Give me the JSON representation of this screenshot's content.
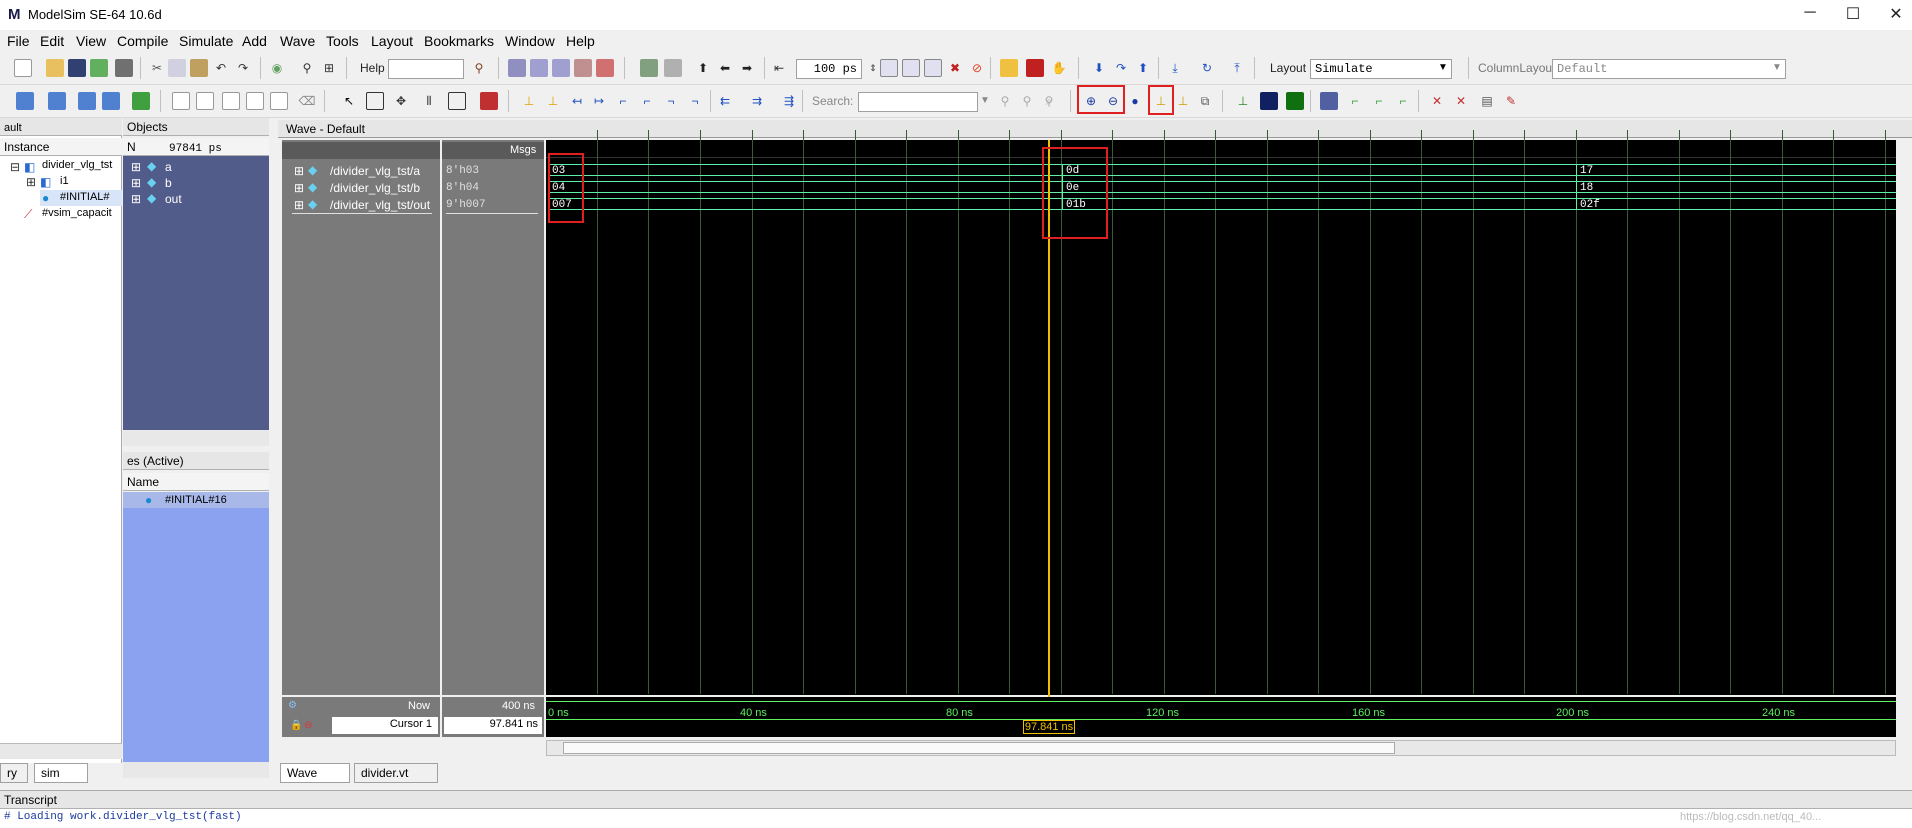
{
  "window": {
    "logo": "M",
    "title": "ModelSim SE-64 10.6d",
    "controls": [
      "─",
      "☐",
      "✕"
    ]
  },
  "menu": [
    "File",
    "Edit",
    "View",
    "Compile",
    "Simulate",
    "Add",
    "Wave",
    "Tools",
    "Layout",
    "Bookmarks",
    "Window",
    "Help"
  ],
  "toolbar1": {
    "help_label": "Help",
    "help_value": "",
    "runlength_value": "100 ps",
    "layout_label": "Layout",
    "layout_value": "Simulate",
    "columnlayout_label": "ColumnLayout",
    "columnlayout_value": "Default"
  },
  "toolbar2": {
    "search_label": "Search:",
    "search_value": ""
  },
  "instance_panel": {
    "title": "ault",
    "header": "Instance",
    "items": [
      "divider_vlg_tst",
      "i1",
      "#INITIAL#",
      "#vsim_capacit"
    ]
  },
  "objects_panel": {
    "title": "Objects",
    "time_value": "97841 ps",
    "filter_label": "N",
    "items": [
      "a",
      "b",
      "out"
    ]
  },
  "processes_panel": {
    "title": "es (Active)",
    "header": "Name",
    "items": [
      "#INITIAL#16"
    ]
  },
  "left_tabs": [
    "ry",
    "sim"
  ],
  "wave": {
    "title": "Wave - Default",
    "msgs_header": "Msgs",
    "signals": [
      {
        "name": "/divider_vlg_tst/a",
        "value": "8'h03",
        "segments": [
          "03",
          "0d",
          "17"
        ]
      },
      {
        "name": "/divider_vlg_tst/b",
        "value": "8'h04",
        "segments": [
          "04",
          "0e",
          "18"
        ]
      },
      {
        "name": "/divider_vlg_tst/out",
        "value": "9'h007",
        "segments": [
          "007",
          "01b",
          "02f"
        ]
      }
    ],
    "now_label": "Now",
    "now_value": "400 ns",
    "cursor_label": "Cursor 1",
    "cursor_value": "97.841 ns",
    "cursor_time_label": "97.841 ns",
    "ticks": [
      "0 ns",
      "40 ns",
      "80 ns",
      "120 ns",
      "160 ns",
      "200 ns",
      "240 ns"
    ],
    "colors": {
      "background": "#000000",
      "bus": "#5ef0a8",
      "cursor": "#f0c000",
      "grid": "#3a5a3a",
      "ticks": "#5ef05e"
    }
  },
  "bottom_tabs": [
    "Wave",
    "divider.vt"
  ],
  "transcript": {
    "title": "Transcript",
    "line": "# Loading work.divider_vlg_tst(fast)"
  },
  "watermark": "https://blog.csdn.net/qq_40..."
}
